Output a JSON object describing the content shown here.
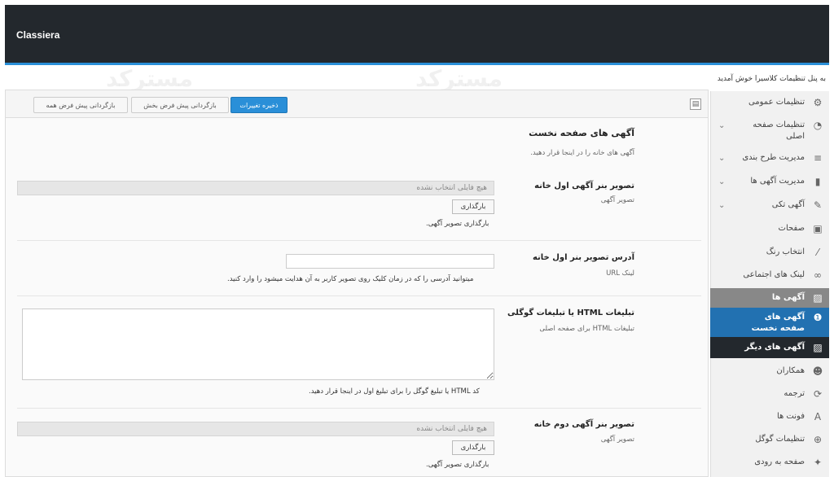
{
  "app": {
    "brand": "Classiera",
    "welcome": "به پنل تنظیمات کلاسیرا خوش آمدید"
  },
  "colors": {
    "accent": "#2a8fd8",
    "topbar": "#23282d",
    "active_item": "#888888",
    "active_sub": "#2271b1",
    "dark_sub": "#23282d"
  },
  "toolbar": {
    "save": "ذخیره تغییرات",
    "reset_section": "بازگردانی پیش فرض بخش",
    "reset_all": "بازگردانی پیش فرض همه",
    "layout_icon": "layout-icon"
  },
  "sidebar": {
    "items": [
      {
        "label": "تنظیمات عمومی",
        "icon": "gear-icon"
      },
      {
        "label": "تنظیمات صفحه اصلی",
        "icon": "dashboard-icon"
      },
      {
        "label": "مدیریت طرح بندی",
        "icon": "list-icon"
      },
      {
        "label": "مدیریت آگهی ها",
        "icon": "bar-chart-icon"
      },
      {
        "label": "آگهی تکی",
        "icon": "pencil-icon"
      },
      {
        "label": "صفحات",
        "icon": "page-icon"
      },
      {
        "label": "انتخاب رنگ",
        "icon": "brush-icon"
      },
      {
        "label": "لینک های اجتماعی",
        "icon": "glasses-icon"
      },
      {
        "label": "آگهی ها",
        "icon": "image-icon"
      },
      {
        "label": "آگهی های صفحه نخست",
        "icon": "home-icon"
      },
      {
        "label": "آگهی های دیگر",
        "icon": "image-icon"
      },
      {
        "label": "همکاران",
        "icon": "users-icon"
      },
      {
        "label": "ترجمه",
        "icon": "refresh-icon"
      },
      {
        "label": "فونت ها",
        "icon": "font-icon"
      },
      {
        "label": "تنظیمات گوگل",
        "icon": "globe-icon"
      },
      {
        "label": "صفحه به رودی",
        "icon": "wand-icon"
      }
    ]
  },
  "section": {
    "title": "آگهی های صفحه نخست",
    "desc": "آگهی های خانه را در اینجا قرار دهید."
  },
  "fields": {
    "banner1": {
      "title": "تصویر بنر آگهی اول خانه",
      "sub": "تصویر آگهی",
      "file_placeholder": "هیچ فایلی انتخاب نشده",
      "upload": "بارگذاری",
      "hint": "بارگذاری تصویر آگهی."
    },
    "banner1_url": {
      "title": "آدرس تصویر بنر اول خانه",
      "sub": "لینک URL",
      "value": "",
      "hint": "میتوانید آدرسی را که در زمان کلیک روی تصویر کاربر به آن هدایت میشود را وارد کنید."
    },
    "html_ads": {
      "title": "تبلیغات HTML یا تبلیغات گوگلی",
      "sub": "تبلیغات HTML برای صفحه اصلی",
      "value": "",
      "hint": "کد HTML یا تبلیغ گوگل را برای تبلیغ اول در اینجا قرار دهید."
    },
    "banner2": {
      "title": "تصویر بنر آگهی دوم خانه",
      "sub": "تصویر آگهی",
      "file_placeholder": "هیچ فایلی انتخاب نشده",
      "upload": "بارگذاری",
      "hint": "بارگذاری تصویر آگهی."
    }
  },
  "watermark": "مسترکد"
}
